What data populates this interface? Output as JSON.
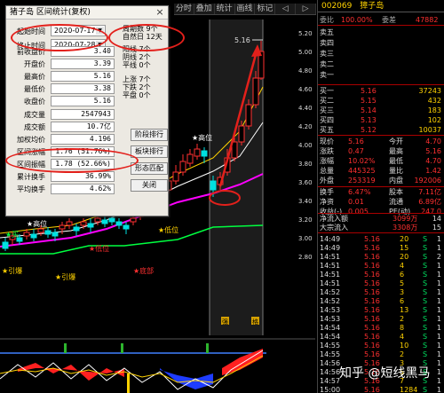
{
  "toolbar": {
    "items": [
      "分时",
      "叠加",
      "统计",
      "画线",
      "标记",
      "◁",
      "▷"
    ]
  },
  "dialog": {
    "title": "猪子岛 区间统计(复权)",
    "start_label": "起始时间",
    "start_value": "2020-07-17",
    "end_label": "终止时间",
    "end_value": "2020-07-28",
    "period_info": "周期数 9个",
    "natural_days": "自然日 12天",
    "yang_lines": "阳线 7个",
    "yin_lines": "阴线 2个",
    "flat_lines": "平线 0个",
    "up_count": "上涨 7个",
    "down_count": "下跌 2个",
    "flat_count": "平盘 0个",
    "fields": [
      {
        "label": "前收盘价",
        "value": "3.40"
      },
      {
        "label": "开盘价",
        "value": "3.39"
      },
      {
        "label": "最高价",
        "value": "5.16"
      },
      {
        "label": "最低价",
        "value": "3.38"
      },
      {
        "label": "收盘价",
        "value": "5.16"
      },
      {
        "label": "成交量",
        "value": "2547943"
      },
      {
        "label": "成交额",
        "value": "10.7亿"
      },
      {
        "label": "加权均价",
        "value": "4.196"
      },
      {
        "label": "区间涨幅",
        "value": "1.76 (51.76%)"
      },
      {
        "label": "区间振幅",
        "value": "1.78 (52.66%)"
      },
      {
        "label": "累计换手",
        "value": "36.99%"
      },
      {
        "label": "平均换手",
        "value": "4.62%"
      }
    ],
    "buttons": [
      "阶段排行",
      "板块排行",
      "形态匹配",
      "关闭"
    ]
  },
  "chart": {
    "price_max_label": "5.16",
    "annotations": [
      "★高位",
      "★高位",
      "★低位",
      "★底部",
      "★引爆",
      "★引爆",
      "★买",
      "★低位"
    ],
    "axis_ticks": [
      "5.20",
      "5.00",
      "4.80",
      "4.60",
      "4.40",
      "4.20",
      "4.00",
      "3.80",
      "3.60",
      "3.40",
      "3.20",
      "3.00",
      "2.80"
    ],
    "bottom_markers": [
      "强",
      "格"
    ]
  },
  "quote": {
    "code": "002069",
    "name": "獐子岛",
    "ratio_label": "委比",
    "ratio_value": "100.00%",
    "diff_label": "委差",
    "diff_value": "47882",
    "sell_levels": [
      "卖五",
      "卖四",
      "卖三",
      "卖二",
      "卖一"
    ],
    "buy_levels": [
      {
        "name": "买一",
        "price": "5.16",
        "vol": "37243"
      },
      {
        "name": "买二",
        "price": "5.15",
        "vol": "432"
      },
      {
        "name": "买三",
        "price": "5.14",
        "vol": "183"
      },
      {
        "name": "买四",
        "price": "5.13",
        "vol": "102"
      },
      {
        "name": "买五",
        "price": "5.12",
        "vol": "10037"
      }
    ],
    "stats": [
      {
        "l1": "现价",
        "v1": "5.16",
        "l2": "今开",
        "v2": "4.70"
      },
      {
        "l1": "涨跌",
        "v1": "0.47",
        "l2": "最高",
        "v2": "5.16"
      },
      {
        "l1": "涨幅",
        "v1": "10.02%",
        "l2": "最低",
        "v2": "4.70"
      },
      {
        "l1": "总量",
        "v1": "445325",
        "l2": "量比",
        "v2": "1.42"
      },
      {
        "l1": "外盘",
        "v1": "253319",
        "l2": "内盘",
        "v2": "192006"
      }
    ],
    "stats2": [
      {
        "l1": "换手",
        "v1": "6.47%",
        "l2": "股本",
        "v2": "7.11亿"
      },
      {
        "l1": "净资",
        "v1": "0.01",
        "l2": "流通",
        "v2": "6.89亿"
      },
      {
        "l1": "收益(-)",
        "v1": "0.005",
        "l2": "PE(动)",
        "v2": "247.0"
      }
    ],
    "flow": [
      {
        "label": "净流入额",
        "value": "3099万",
        "tag": "14"
      },
      {
        "label": "大宗流入",
        "value": "3308万",
        "tag": "15"
      }
    ],
    "ticks": [
      {
        "t": "14:49",
        "p": "5.16",
        "v": "20",
        "d": "S",
        "n": "1"
      },
      {
        "t": "14:49",
        "p": "5.16",
        "v": "15",
        "d": "S",
        "n": "1"
      },
      {
        "t": "14:51",
        "p": "5.16",
        "v": "20",
        "d": "S",
        "n": "2"
      },
      {
        "t": "14:51",
        "p": "5.16",
        "v": "4",
        "d": "S",
        "n": "1"
      },
      {
        "t": "14:51",
        "p": "5.16",
        "v": "6",
        "d": "S",
        "n": "1"
      },
      {
        "t": "14:51",
        "p": "5.16",
        "v": "5",
        "d": "S",
        "n": "1"
      },
      {
        "t": "14:52",
        "p": "5.16",
        "v": "3",
        "d": "S",
        "n": "1"
      },
      {
        "t": "14:52",
        "p": "5.16",
        "v": "6",
        "d": "S",
        "n": "1"
      },
      {
        "t": "14:53",
        "p": "5.16",
        "v": "13",
        "d": "S",
        "n": "1"
      },
      {
        "t": "14:53",
        "p": "5.16",
        "v": "2",
        "d": "S",
        "n": "1"
      },
      {
        "t": "14:54",
        "p": "5.16",
        "v": "8",
        "d": "S",
        "n": "1"
      },
      {
        "t": "14:54",
        "p": "5.16",
        "v": "4",
        "d": "S",
        "n": "1"
      },
      {
        "t": "14:55",
        "p": "5.16",
        "v": "10",
        "d": "S",
        "n": "1"
      },
      {
        "t": "14:55",
        "p": "5.16",
        "v": "2",
        "d": "S",
        "n": "1"
      },
      {
        "t": "14:56",
        "p": "5.16",
        "v": "3",
        "d": "S",
        "n": "1"
      },
      {
        "t": "14:56",
        "p": "5.16",
        "v": "5",
        "d": "S",
        "n": "1"
      },
      {
        "t": "14:57",
        "p": "5.16",
        "v": "7",
        "d": "S",
        "n": "1"
      },
      {
        "t": "15:00",
        "p": "5.16",
        "v": "1284",
        "d": "S",
        "n": "1"
      }
    ]
  },
  "watermark": "知乎 @短线黑马",
  "colors": {
    "up": "#ff3030",
    "down": "#00e060",
    "accent": "#ffd200",
    "highlight": "#e3201b"
  }
}
